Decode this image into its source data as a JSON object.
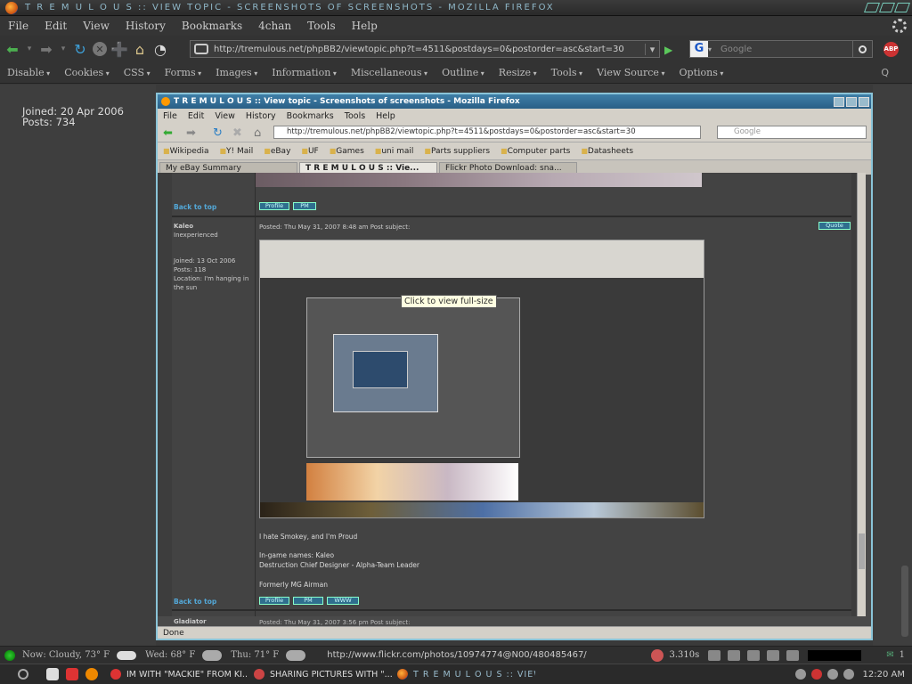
{
  "window": {
    "title": "T R E M U L O U S :: VIEW TOPIC - SCREENSHOTS OF SCREENSHOTS - MOZILLA FIREFOX"
  },
  "menubar": [
    "File",
    "Edit",
    "View",
    "History",
    "Bookmarks",
    "4chan",
    "Tools",
    "Help"
  ],
  "navbar": {
    "url": "http://tremulous.net/phpBB2/viewtopic.php?t=4511&postdays=0&postorder=asc&start=30",
    "search_placeholder": "Google",
    "abp_label": "ABP"
  },
  "devbar": [
    "Disable",
    "Cookies",
    "CSS",
    "Forms",
    "Images",
    "Information",
    "Miscellaneous",
    "Outline",
    "Resize",
    "Tools",
    "View Source",
    "Options"
  ],
  "devbar_right": "Q",
  "profile": {
    "joined": "Joined: 20 Apr 2006",
    "posts": "Posts: 734"
  },
  "inner": {
    "title": "T R E M U L O U S :: View topic - Screenshots of screenshots - Mozilla Firefox",
    "menu": [
      "File",
      "Edit",
      "View",
      "History",
      "Bookmarks",
      "Tools",
      "Help"
    ],
    "url": "http://tremulous.net/phpBB2/viewtopic.php?t=4511&postdays=0&postorder=asc&start=30",
    "search_placeholder": "Google",
    "bookmarks": [
      "Wikipedia",
      "Y! Mail",
      "eBay",
      "UF",
      "Games",
      "uni mail",
      "Parts suppliers",
      "Computer parts",
      "Datasheets"
    ],
    "tabs": [
      "My eBay Summary",
      "T R E M U L O U S :: Vie...",
      "Flickr Photo Download: sna..."
    ],
    "status": "Done",
    "back_to_top": "Back to top",
    "profile_btn": "Profile",
    "pm_btn": "PM",
    "www_btn": "WWW",
    "quote_btn": "Quote",
    "poster1": "Kaleo",
    "poster1_rank": "Inexperienced",
    "poster1_info": [
      "Joined: 13 Oct 2006",
      "Posts: 118",
      "Location: I'm hanging in the sun"
    ],
    "post_header": "Posted: Thu May 31, 2007 8:48 am    Post subject:",
    "tooltip": "Click to view full-size",
    "signature": [
      "I hate Smokey, and I'm Proud",
      "In-game names: Kaleo",
      "Destruction Chief Designer - Alpha-Team Leader",
      "Formerly MG Airman"
    ],
    "poster2": "Gladiator",
    "post2_header": "Posted: Thu May 31, 2007 3:56 pm    Post subject:"
  },
  "statusbar": {
    "weather_now": "Now: Cloudy, 73° F",
    "weather_wed": "Wed: 68° F",
    "weather_thu": "Thu: 71° F",
    "link": "http://www.flickr.com/photos/10974774@N00/480485467/",
    "timing": "3.310s",
    "mail_count": "1"
  },
  "taskbar": {
    "tasks": [
      "IM WITH \"MACKIE\" FROM KI...",
      "SHARING PICTURES WITH \"...",
      "T R E M U L O U S :: VIEW T..."
    ],
    "clock": "12:20 AM"
  }
}
